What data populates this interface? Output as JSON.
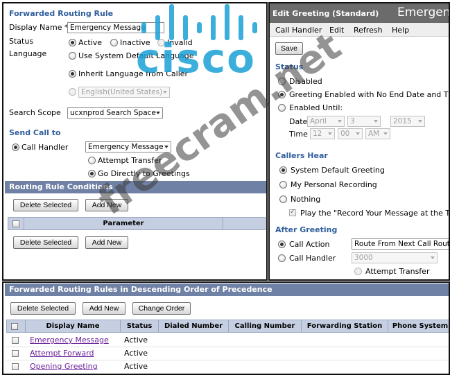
{
  "routing_rule": {
    "title": "Forwarded Routing Rule",
    "display_name_label": "Display Name *",
    "display_name_value": "Emergency Message",
    "status_label": "Status",
    "status_options": [
      "Active",
      "Inactive",
      "Invalid"
    ],
    "status_selected": "Active",
    "language_label": "Language",
    "language_options": [
      "Use System Default Language",
      "Inherit Language from Caller"
    ],
    "language_selected": "Inherit Language from Caller",
    "language_specific_value": "English(United States)",
    "search_scope_label": "Search Scope",
    "search_scope_value": "ucxnprod Search Space",
    "send_call_to_title": "Send Call to",
    "call_handler_label": "Call Handler",
    "call_handler_value": "Emergency Message",
    "transfer_options": [
      "Attempt Transfer",
      "Go Directly to Greetings"
    ],
    "transfer_selected": "Go Directly to Greetings",
    "conditions_title": "Routing Rule Conditions",
    "delete_selected_label": "Delete Selected",
    "add_new_label": "Add New",
    "parameter_header": "Parameter"
  },
  "greeting": {
    "title": "Edit Greeting  (Standard)",
    "title_right": "Emergenc",
    "menu": [
      "Call Handler",
      "Edit",
      "Refresh",
      "Help"
    ],
    "save_label": "Save",
    "status_title": "Status",
    "status_options": [
      "Disabled",
      "Greeting Enabled with No End Date and Time",
      "Enabled Until:"
    ],
    "status_selected": "Greeting Enabled with No End Date and Time",
    "date_label": "Date",
    "date_month": "April",
    "date_day": "3",
    "date_year": "2015",
    "time_label": "Time",
    "time_hour": "12",
    "time_minute": "00",
    "time_ampm": "AM",
    "callers_hear_title": "Callers Hear",
    "callers_hear_options": [
      "System Default Greeting",
      "My Personal Recording",
      "Nothing"
    ],
    "callers_hear_selected": "System Default Greeting",
    "play_record_label": "Play the \"Record Your Message at the Tone",
    "after_greeting_title": "After Greeting",
    "call_action_label": "Call Action",
    "call_action_value": "Route From Next Call Routing",
    "after_call_handler_label": "Call Handler",
    "after_call_handler_value": "3000",
    "attempt_transfer_label": "Attempt Transfer"
  },
  "rules_list": {
    "title": "Forwarded Routing Rules in Descending Order of Precedence",
    "delete_selected_label": "Delete Selected",
    "add_new_label": "Add New",
    "change_order_label": "Change Order",
    "columns": [
      "Display Name",
      "Status",
      "Dialed Number",
      "Calling Number",
      "Forwarding Station",
      "Phone System"
    ],
    "rows": [
      {
        "name": "Emergency Message",
        "status": "Active"
      },
      {
        "name": "Attempt Forward",
        "status": "Active"
      },
      {
        "name": "Opening Greeting",
        "status": "Active"
      }
    ]
  },
  "watermark": {
    "brand": "cisco",
    "site": "freecram.net"
  },
  "colors": {
    "section_title": "#2f5e9c",
    "header_bar": "#6f81a4",
    "table_header": "#c6cfe2",
    "link": "#6a1f9a",
    "cisco_blue": "#1ba0d7"
  }
}
